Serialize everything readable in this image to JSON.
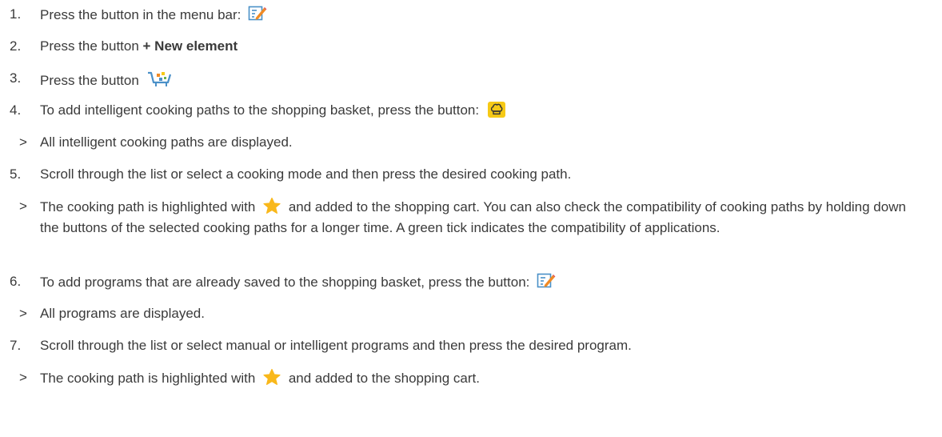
{
  "steps": [
    {
      "marker": "1.",
      "text": "Press the button in the menu bar:",
      "icon": "edit-icon"
    },
    {
      "marker": "2.",
      "text_before": "Press the button ",
      "bold": "+ New element"
    },
    {
      "marker": "3.",
      "text": "Press the button",
      "icon": "shopping-cart-icon"
    },
    {
      "marker": "4.",
      "text": "To add intelligent cooking paths to the shopping basket, press the button:",
      "icon": "chef-hat-icon"
    },
    {
      "marker": ">",
      "text": "All intelligent cooking paths are displayed."
    },
    {
      "marker": "5.",
      "text": "Scroll through the list or select a cooking mode and then press the desired cooking path."
    },
    {
      "marker": ">",
      "text_before": "The cooking path is highlighted with",
      "icon": "star-icon",
      "text_after": "and added to the shopping cart. You can also check the compatibility of cooking paths by holding down the buttons of the selected cooking paths for a longer time. A green tick indicates the compatibility of applications."
    },
    {
      "marker": "6.",
      "text": "To add programs that are already saved to the shopping basket, press the button:",
      "icon": "edit-icon"
    },
    {
      "marker": ">",
      "text": "All programs are displayed."
    },
    {
      "marker": "7.",
      "text": "Scroll through the list or select manual or intelligent programs and then press the desired program."
    },
    {
      "marker": ">",
      "text_before": "The cooking path is highlighted with",
      "icon": "star-icon",
      "text_after": "and added to the shopping cart."
    }
  ],
  "colors": {
    "text": "#3a3a3a",
    "icon_blue": "#4a90c8",
    "icon_orange": "#f08a24",
    "icon_yellow": "#f6c916",
    "star_yellow": "#f9b81b"
  }
}
